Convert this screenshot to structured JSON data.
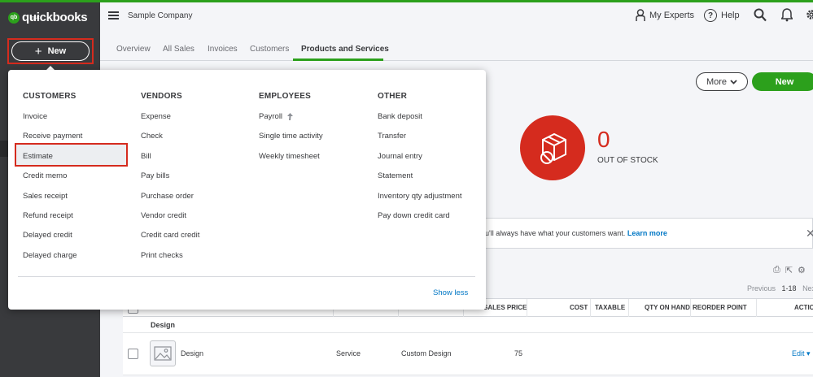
{
  "app": {
    "logo_small": "intuit",
    "logo_text": "quickbooks",
    "logo_badge": "qb",
    "new_button": "New",
    "company": "Sample Company"
  },
  "header": {
    "my_experts": "My Experts",
    "help": "Help"
  },
  "tabs": [
    "Overview",
    "All Sales",
    "Invoices",
    "Customers",
    "Products and Services"
  ],
  "menu": {
    "columns": [
      {
        "title": "CUSTOMERS",
        "items": [
          "Invoice",
          "Receive payment",
          "Estimate",
          "Credit memo",
          "Sales receipt",
          "Refund receipt",
          "Delayed credit",
          "Delayed charge"
        ]
      },
      {
        "title": "VENDORS",
        "items": [
          "Expense",
          "Check",
          "Bill",
          "Pay bills",
          "Purchase order",
          "Vendor credit",
          "Credit card credit",
          "Print checks"
        ]
      },
      {
        "title": "EMPLOYEES",
        "items": [
          "Payroll",
          "Single time activity",
          "Weekly timesheet"
        ]
      },
      {
        "title": "OTHER",
        "items": [
          "Bank deposit",
          "Transfer",
          "Journal entry",
          "Statement",
          "Inventory qty adjustment",
          "Pay down credit card"
        ]
      }
    ],
    "show_less": "Show less"
  },
  "actions": {
    "more": "More",
    "new": "New"
  },
  "stock": {
    "count": "0",
    "label": "OUT OF STOCK"
  },
  "banner": {
    "text": "ou'll always have what your customers want.",
    "link": "Learn more"
  },
  "pager": {
    "previous": "Previous",
    "range": "1-18",
    "next": "Nex"
  },
  "table": {
    "columns": [
      "SALES PRICE",
      "COST",
      "TAXABLE",
      "QTY ON HAND",
      "REORDER POINT",
      "ACTIO"
    ],
    "group": "Design",
    "rows": [
      {
        "name": "Design",
        "type": "Service",
        "description": "Custom Design",
        "price": "75",
        "action": "Edit"
      }
    ]
  },
  "colors": {
    "brand_green": "#2ca01c",
    "sidebar": "#393a3d",
    "highlight_red": "#d52b1e",
    "link_blue": "#0077c5"
  }
}
